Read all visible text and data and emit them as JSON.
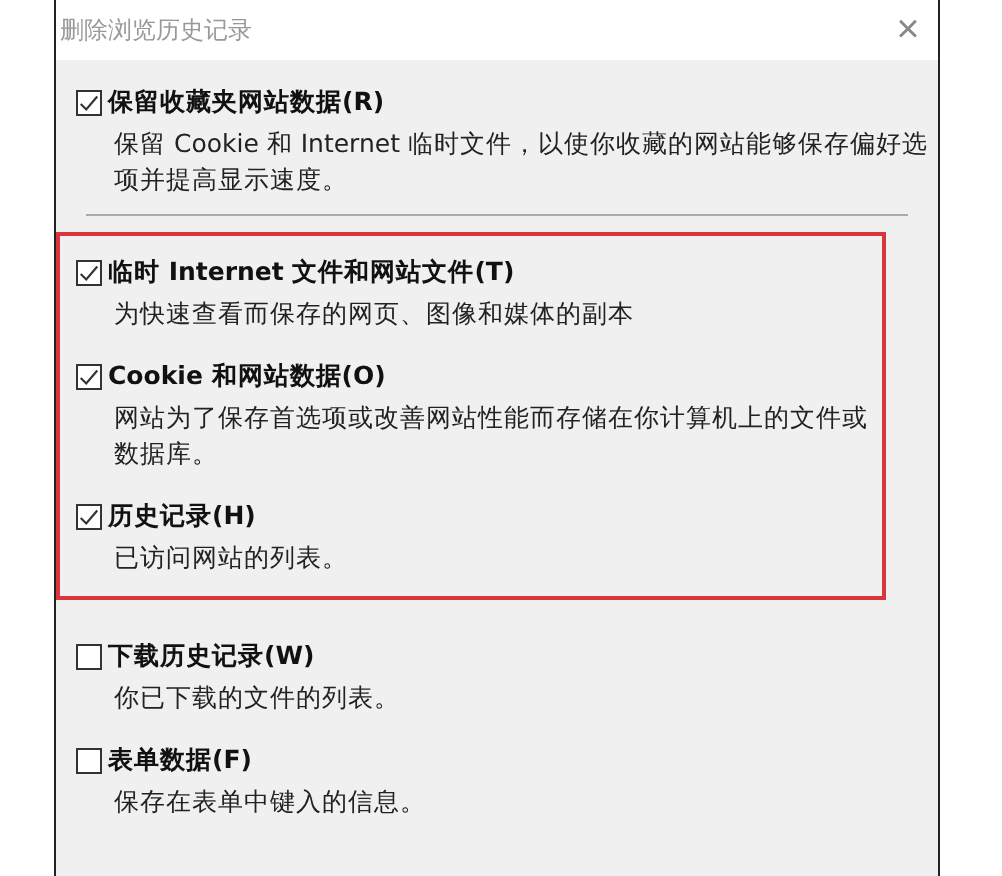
{
  "window": {
    "title": "删除浏览历史记录",
    "close": "×"
  },
  "groups": [
    {
      "highlighted": false,
      "divider_after": true,
      "items": [
        {
          "label": "保留收藏夹网站数据(R)",
          "checked": true,
          "description": "保留 Cookie 和 Internet 临时文件，以使你收藏的网站能够保存偏好选项并提高显示速度。"
        }
      ]
    },
    {
      "highlighted": true,
      "divider_after": false,
      "items": [
        {
          "label": "临时 Internet 文件和网站文件(T)",
          "checked": true,
          "description": "为快速查看而保存的网页、图像和媒体的副本"
        },
        {
          "label": "Cookie 和网站数据(O)",
          "checked": true,
          "description": "网站为了保存首选项或改善网站性能而存储在你计算机上的文件或数据库。"
        },
        {
          "label": "历史记录(H)",
          "checked": true,
          "description": "已访问网站的列表。"
        }
      ]
    },
    {
      "highlighted": false,
      "divider_after": false,
      "items": [
        {
          "label": "下载历史记录(W)",
          "checked": false,
          "description": "你已下载的文件的列表。"
        },
        {
          "label": "表单数据(F)",
          "checked": false,
          "description": "保存在表单中键入的信息。"
        }
      ]
    }
  ]
}
